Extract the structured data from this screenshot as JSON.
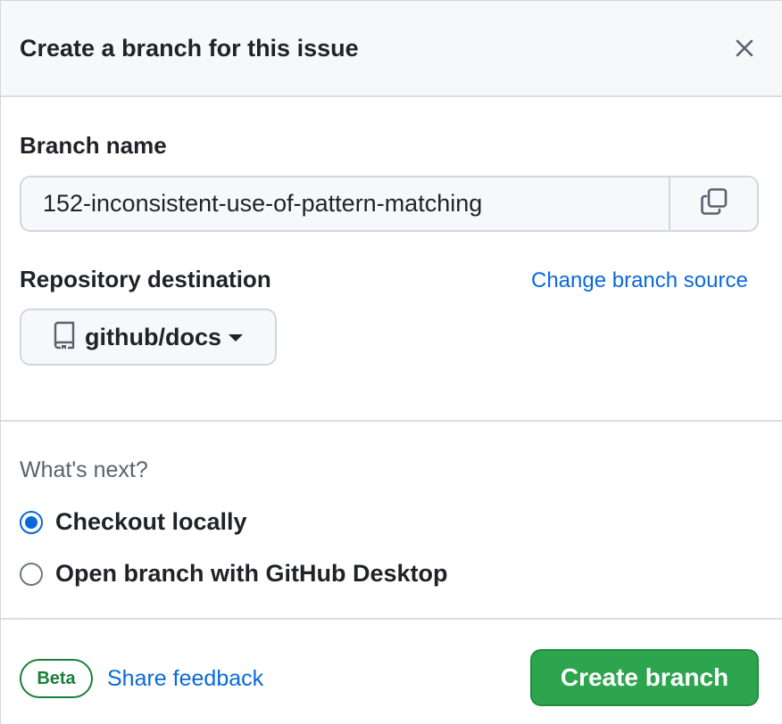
{
  "dialog": {
    "title": "Create a branch for this issue"
  },
  "branch": {
    "label": "Branch name",
    "value": "152-inconsistent-use-of-pattern-matching"
  },
  "repository": {
    "label": "Repository destination",
    "change_source_link": "Change branch source",
    "selected": "github/docs"
  },
  "next_steps": {
    "heading": "What's next?",
    "options": [
      {
        "label": "Checkout locally",
        "checked": true
      },
      {
        "label": "Open branch with GitHub Desktop",
        "checked": false
      }
    ]
  },
  "footer": {
    "badge": "Beta",
    "feedback_link": "Share feedback",
    "create_button": "Create branch"
  },
  "colors": {
    "accent": "#0969da",
    "primary_button": "#2da44e",
    "badge": "#1a7f37"
  },
  "icons": {
    "close": "x-icon",
    "copy": "copy-icon",
    "repo": "repo-icon",
    "caret": "triangle-down-icon"
  }
}
